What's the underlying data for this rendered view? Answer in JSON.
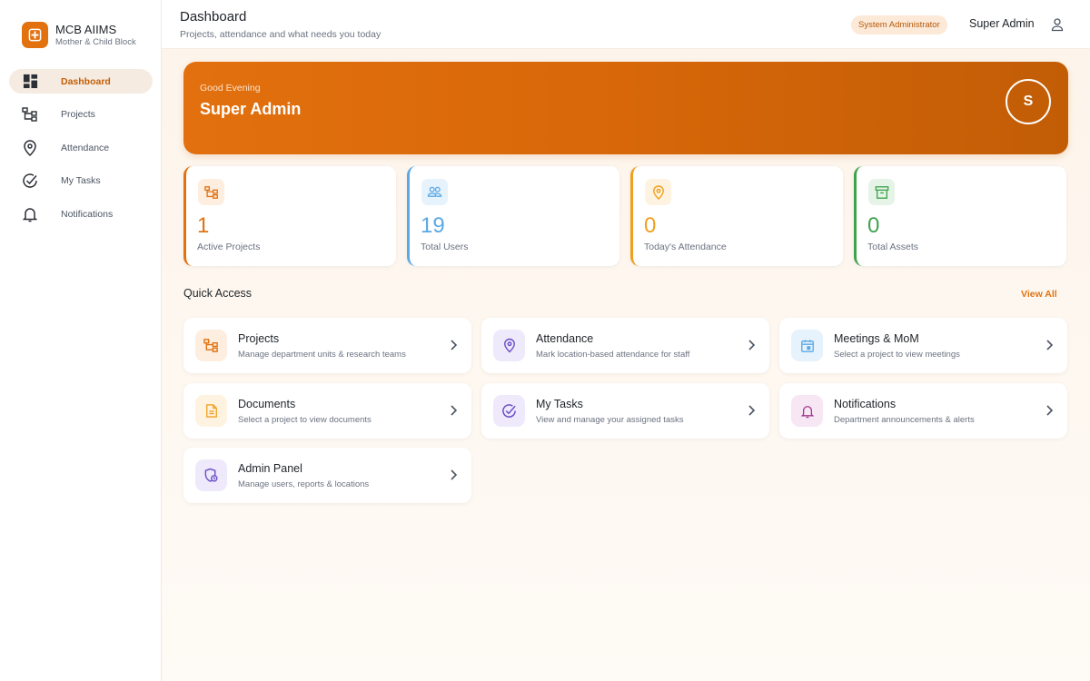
{
  "brand": {
    "name": "MCB AIIMS",
    "subtitle": "Mother & Child Block"
  },
  "sidebar": {
    "items": [
      {
        "label": "Dashboard",
        "icon": "dashboard-icon",
        "active": true
      },
      {
        "label": "Projects",
        "icon": "hierarchy-icon",
        "active": false
      },
      {
        "label": "Attendance",
        "icon": "location-pin-icon",
        "active": false
      },
      {
        "label": "My Tasks",
        "icon": "check-circle-icon",
        "active": false
      },
      {
        "label": "Notifications",
        "icon": "bell-icon",
        "active": false
      }
    ]
  },
  "header": {
    "title": "Dashboard",
    "subtitle": "Projects, attendance and what needs you today",
    "role_badge": "System Administrator",
    "user_name": "Super Admin"
  },
  "hero": {
    "greeting": "Good Evening",
    "name": "Super Admin",
    "avatar_initial": "S"
  },
  "stats": [
    {
      "value": "1",
      "label": "Active Projects",
      "color": "#e27210",
      "icon": "hierarchy-icon"
    },
    {
      "value": "19",
      "label": "Total Users",
      "color": "#5aa9e6",
      "icon": "users-icon"
    },
    {
      "value": "0",
      "label": "Today's Attendance",
      "color": "#f0a020",
      "icon": "location-pin-icon"
    },
    {
      "value": "0",
      "label": "Total Assets",
      "color": "#3fa34d",
      "icon": "archive-icon"
    }
  ],
  "quick_access": {
    "title": "Quick Access",
    "view_all": "View All",
    "cards": [
      {
        "name": "Projects",
        "desc": "Manage department units & research teams",
        "icon": "hierarchy-icon"
      },
      {
        "name": "Attendance",
        "desc": "Mark location-based attendance for staff",
        "icon": "location-pin-icon"
      },
      {
        "name": "Meetings & MoM",
        "desc": "Select a project to view meetings",
        "icon": "calendar-icon"
      },
      {
        "name": "Documents",
        "desc": "Select a project to view documents",
        "icon": "document-icon"
      },
      {
        "name": "My Tasks",
        "desc": "View and manage your assigned tasks",
        "icon": "check-circle-icon"
      },
      {
        "name": "Notifications",
        "desc": "Department announcements & alerts",
        "icon": "bell-icon"
      },
      {
        "name": "Admin Panel",
        "desc": "Manage users, reports & locations",
        "icon": "admin-shield-icon"
      }
    ]
  },
  "colors": {
    "accent": "#e27210",
    "accent_dark": "#c25e08"
  }
}
